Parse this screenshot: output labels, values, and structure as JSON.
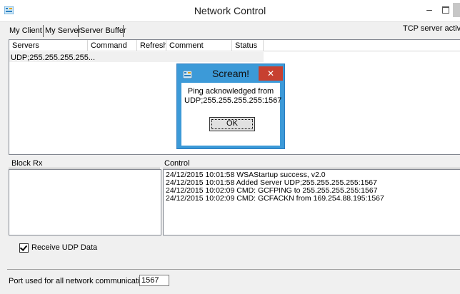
{
  "window": {
    "title": "Network Control",
    "minimize_glyph": "–",
    "close_glyph": "✕",
    "icon": "network-app-icon"
  },
  "tabs": [
    {
      "label": "My Client",
      "selected": true
    },
    {
      "label": "My Server",
      "selected": false
    },
    {
      "label": "Server Buffer",
      "selected": false
    }
  ],
  "status": {
    "tcp": "TCP server active"
  },
  "servers_table": {
    "columns": [
      "Servers",
      "Command",
      "Refresh",
      "Comment",
      "Status"
    ],
    "rows": [
      {
        "server": "UDP;255.255.255.255...",
        "command": "",
        "refresh": "",
        "comment": "",
        "status": ""
      }
    ]
  },
  "block_rx": {
    "label": "Block Rx",
    "lines": []
  },
  "control": {
    "label": "Control",
    "lines": [
      "24/12/2015 10:01:58  WSAStartup success, v2.0",
      "24/12/2015 10:01:58  Added Server UDP;255.255.255.255:1567",
      "24/12/2015 10:02:09  CMD: GCFPING to 255.255.255.255:1567",
      "24/12/2015 10:02:09  CMD: GCFACKN from 169.254.88.195:1567"
    ]
  },
  "options": {
    "receive_udp_label": "Receive UDP Data",
    "receive_udp_checked": true
  },
  "port": {
    "label": "Port used for all network communications:",
    "value": "1567"
  },
  "dialog": {
    "title": "Scream!",
    "message_line1": "Ping acknowledged from",
    "message_line2": "UDP;255.255.255.255:1567",
    "ok_label": "OK",
    "close_glyph": "✕"
  },
  "colors": {
    "dialog_frame": "#3c9ad8",
    "dialog_close": "#c74030"
  }
}
